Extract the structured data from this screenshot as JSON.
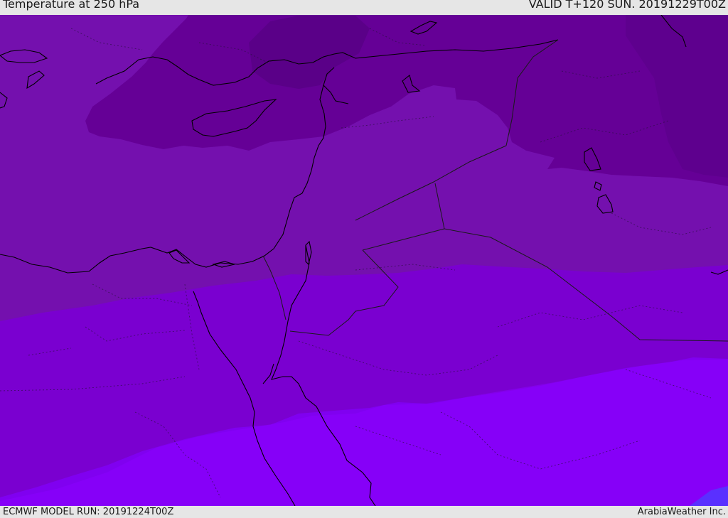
{
  "header": {
    "title": "Temperature at 250 hPa",
    "valid_time": "VALID T+120 SUN. 20191229T00Z"
  },
  "footer": {
    "model_run": "ECMWF MODEL RUN: 20191224T00Z",
    "credit": "ArabiaWeather Inc."
  },
  "map": {
    "variable": "temperature",
    "level": "250 hPa",
    "legend": "none",
    "colors": {
      "band_darkest": "#5a0088",
      "band_dark": "#650096",
      "band_mid": "#7410ae",
      "band_violet": "#7a00d0",
      "band_bright": "#8000f0",
      "band_brightest": "#8a00ff",
      "band_blue_corner": "#5a30ff",
      "coastline": "#000000",
      "border": "#1a1a1a"
    }
  }
}
